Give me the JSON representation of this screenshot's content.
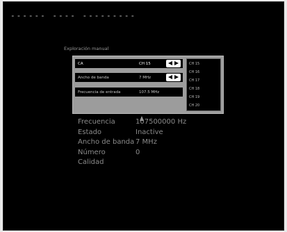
{
  "header": {
    "dashes": "------ ---- ---------"
  },
  "menu": {
    "title": "Exploración manual",
    "rows": [
      {
        "label": "CA",
        "value": "CH 15"
      },
      {
        "label": "Ancho de banda",
        "value": "7 MHz"
      },
      {
        "label": "Frecuencia de entrada",
        "value": "107.5 MHz"
      }
    ],
    "channels": [
      "CH 15",
      "CH 16",
      "CH 17",
      "CH 18",
      "CH 19",
      "CH 20"
    ]
  },
  "info": {
    "labels": [
      "Frecuencia",
      "Estado",
      "Ancho de banda",
      "Número",
      "Calidad"
    ],
    "values": [
      "107500000 Hz",
      "Inactive",
      "7 MHz",
      "0",
      ""
    ]
  },
  "icons": {
    "arrows": "left-right-arrow-icon",
    "cursor": "mouse-cursor-icon"
  }
}
